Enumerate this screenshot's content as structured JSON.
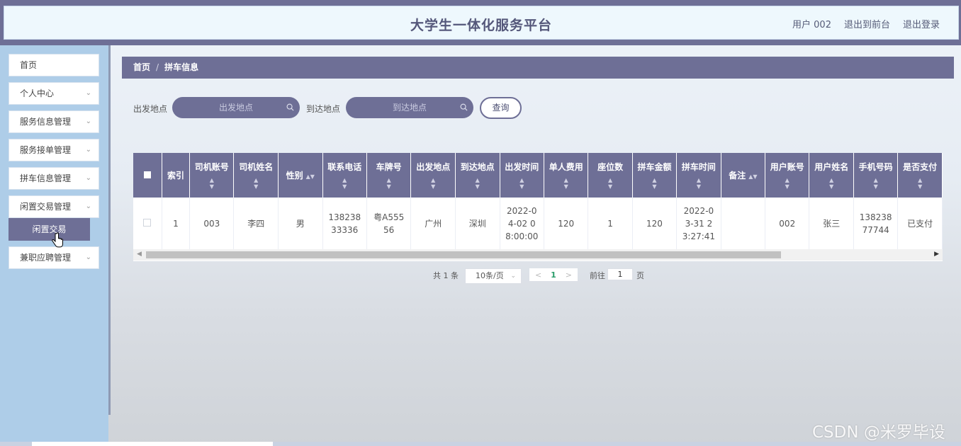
{
  "header": {
    "title": "大学生一体化服务平台",
    "user": "用户 002",
    "exit_front": "退出到前台",
    "logout": "退出登录"
  },
  "sidebar": {
    "items": [
      {
        "label": "首页",
        "has_arrow": false
      },
      {
        "label": "个人中心",
        "has_arrow": true
      },
      {
        "label": "服务信息管理",
        "has_arrow": true
      },
      {
        "label": "服务接单管理",
        "has_arrow": true
      },
      {
        "label": "拼车信息管理",
        "has_arrow": true
      },
      {
        "label": "闲置交易管理",
        "has_arrow": true
      },
      {
        "label": "兼职应聘管理",
        "has_arrow": true
      }
    ],
    "active_sub": "闲置交易"
  },
  "breadcrumb": {
    "home": "首页",
    "sep": "/",
    "current": "拼车信息"
  },
  "search": {
    "from_label": "出发地点",
    "from_placeholder": "出发地点",
    "to_label": "到达地点",
    "to_placeholder": "到达地点",
    "button": "查询"
  },
  "table": {
    "columns": [
      "索引",
      "司机账号",
      "司机姓名",
      "性别",
      "联系电话",
      "车牌号",
      "出发地点",
      "到达地点",
      "出发时间",
      "单人费用",
      "座位数",
      "拼车金额",
      "拼车时间",
      "备注",
      "用户账号",
      "用户姓名",
      "手机号码",
      "是否支付"
    ],
    "rows": [
      [
        "1",
        "003",
        "李四",
        "男",
        "13823833336",
        "粤A55556",
        "广州",
        "深圳",
        "2022-04-02 08:00:00",
        "120",
        "1",
        "120",
        "2022-03-31 23:27:41",
        "",
        "002",
        "张三",
        "13823877744",
        "已支付"
      ]
    ]
  },
  "pagination": {
    "total": "共 1 条",
    "page_size": "10条/页",
    "current_page": "1",
    "goto_label": "前往",
    "goto_value": "1",
    "page_unit": "页"
  },
  "watermark": "CSDN @米罗毕设",
  "colors": {
    "primary": "#6e6f96",
    "sidebar": "#aecde8",
    "header_bg": "#eef8fd"
  }
}
